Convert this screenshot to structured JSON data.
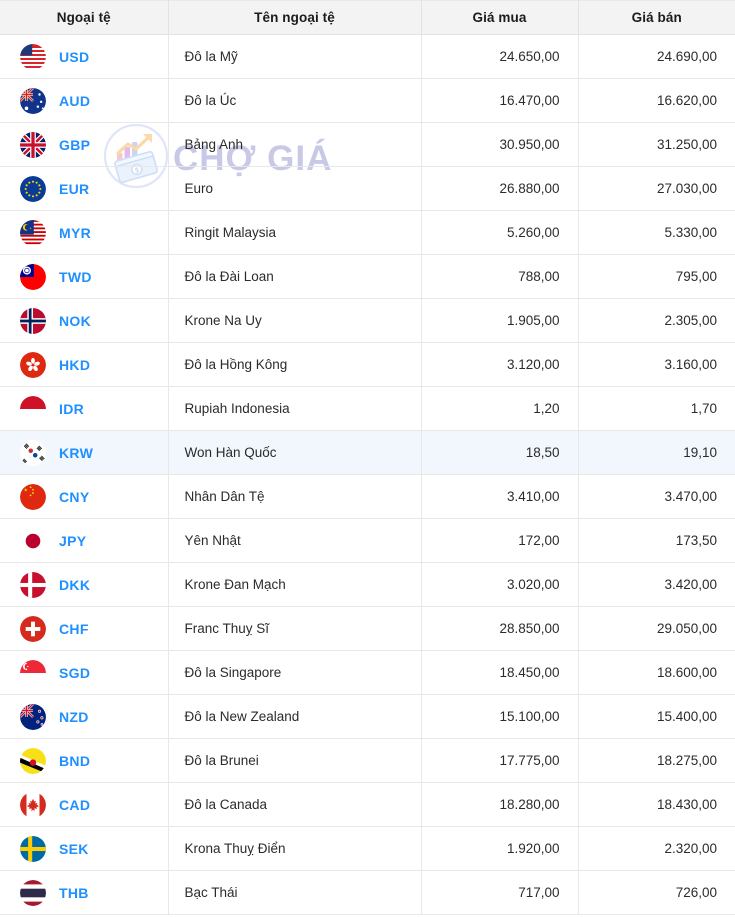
{
  "table": {
    "columns": [
      {
        "key": "code",
        "label": "Ngoại tệ",
        "align": "center"
      },
      {
        "key": "name",
        "label": "Tên ngoại tệ",
        "align": "center"
      },
      {
        "key": "buy",
        "label": "Giá mua",
        "align": "center"
      },
      {
        "key": "sell",
        "label": "Giá bán",
        "align": "center"
      }
    ],
    "accent_code_color": "#1f90ff",
    "header_bg": "#f3f3f3",
    "highlight_row_bg": "#f1f7fd",
    "rows": [
      {
        "code": "USD",
        "flag": "flag-us-icon",
        "name": "Đô la Mỹ",
        "buy": "24.650,00",
        "sell": "24.690,00",
        "highlight": false
      },
      {
        "code": "AUD",
        "flag": "flag-au-icon",
        "name": "Đô la Úc",
        "buy": "16.470,00",
        "sell": "16.620,00",
        "highlight": false
      },
      {
        "code": "GBP",
        "flag": "flag-gb-icon",
        "name": "Bảng Anh",
        "buy": "30.950,00",
        "sell": "31.250,00",
        "highlight": false
      },
      {
        "code": "EUR",
        "flag": "flag-eu-icon",
        "name": "Euro",
        "buy": "26.880,00",
        "sell": "27.030,00",
        "highlight": false
      },
      {
        "code": "MYR",
        "flag": "flag-my-icon",
        "name": "Ringit Malaysia",
        "buy": "5.260,00",
        "sell": "5.330,00",
        "highlight": false
      },
      {
        "code": "TWD",
        "flag": "flag-tw-icon",
        "name": "Đô la Đài Loan",
        "buy": "788,00",
        "sell": "795,00",
        "highlight": false
      },
      {
        "code": "NOK",
        "flag": "flag-no-icon",
        "name": "Krone Na Uy",
        "buy": "1.905,00",
        "sell": "2.305,00",
        "highlight": false
      },
      {
        "code": "HKD",
        "flag": "flag-hk-icon",
        "name": "Đô la Hồng Kông",
        "buy": "3.120,00",
        "sell": "3.160,00",
        "highlight": false
      },
      {
        "code": "IDR",
        "flag": "flag-id-icon",
        "name": "Rupiah Indonesia",
        "buy": "1,20",
        "sell": "1,70",
        "highlight": false
      },
      {
        "code": "KRW",
        "flag": "flag-kr-icon",
        "name": "Won Hàn Quốc",
        "buy": "18,50",
        "sell": "19,10",
        "highlight": true
      },
      {
        "code": "CNY",
        "flag": "flag-cn-icon",
        "name": "Nhân Dân Tệ",
        "buy": "3.410,00",
        "sell": "3.470,00",
        "highlight": false
      },
      {
        "code": "JPY",
        "flag": "flag-jp-icon",
        "name": "Yên Nhật",
        "buy": "172,00",
        "sell": "173,50",
        "highlight": false
      },
      {
        "code": "DKK",
        "flag": "flag-dk-icon",
        "name": "Krone Đan Mạch",
        "buy": "3.020,00",
        "sell": "3.420,00",
        "highlight": false
      },
      {
        "code": "CHF",
        "flag": "flag-ch-icon",
        "name": "Franc Thuỵ Sĩ",
        "buy": "28.850,00",
        "sell": "29.050,00",
        "highlight": false
      },
      {
        "code": "SGD",
        "flag": "flag-sg-icon",
        "name": "Đô la Singapore",
        "buy": "18.450,00",
        "sell": "18.600,00",
        "highlight": false
      },
      {
        "code": "NZD",
        "flag": "flag-nz-icon",
        "name": "Đô la New Zealand",
        "buy": "15.100,00",
        "sell": "15.400,00",
        "highlight": false
      },
      {
        "code": "BND",
        "flag": "flag-bn-icon",
        "name": "Đô la Brunei",
        "buy": "17.775,00",
        "sell": "18.275,00",
        "highlight": false
      },
      {
        "code": "CAD",
        "flag": "flag-ca-icon",
        "name": "Đô la Canada",
        "buy": "18.280,00",
        "sell": "18.430,00",
        "highlight": false
      },
      {
        "code": "SEK",
        "flag": "flag-se-icon",
        "name": "Krona Thuỵ Điển",
        "buy": "1.920,00",
        "sell": "2.320,00",
        "highlight": false
      },
      {
        "code": "THB",
        "flag": "flag-th-icon",
        "name": "Bạc Thái",
        "buy": "717,00",
        "sell": "726,00",
        "highlight": false
      }
    ]
  },
  "watermark": {
    "text": "CHỢ GIÁ",
    "mark": "chart-money-logo-icon",
    "color": "#c7c9e6"
  }
}
